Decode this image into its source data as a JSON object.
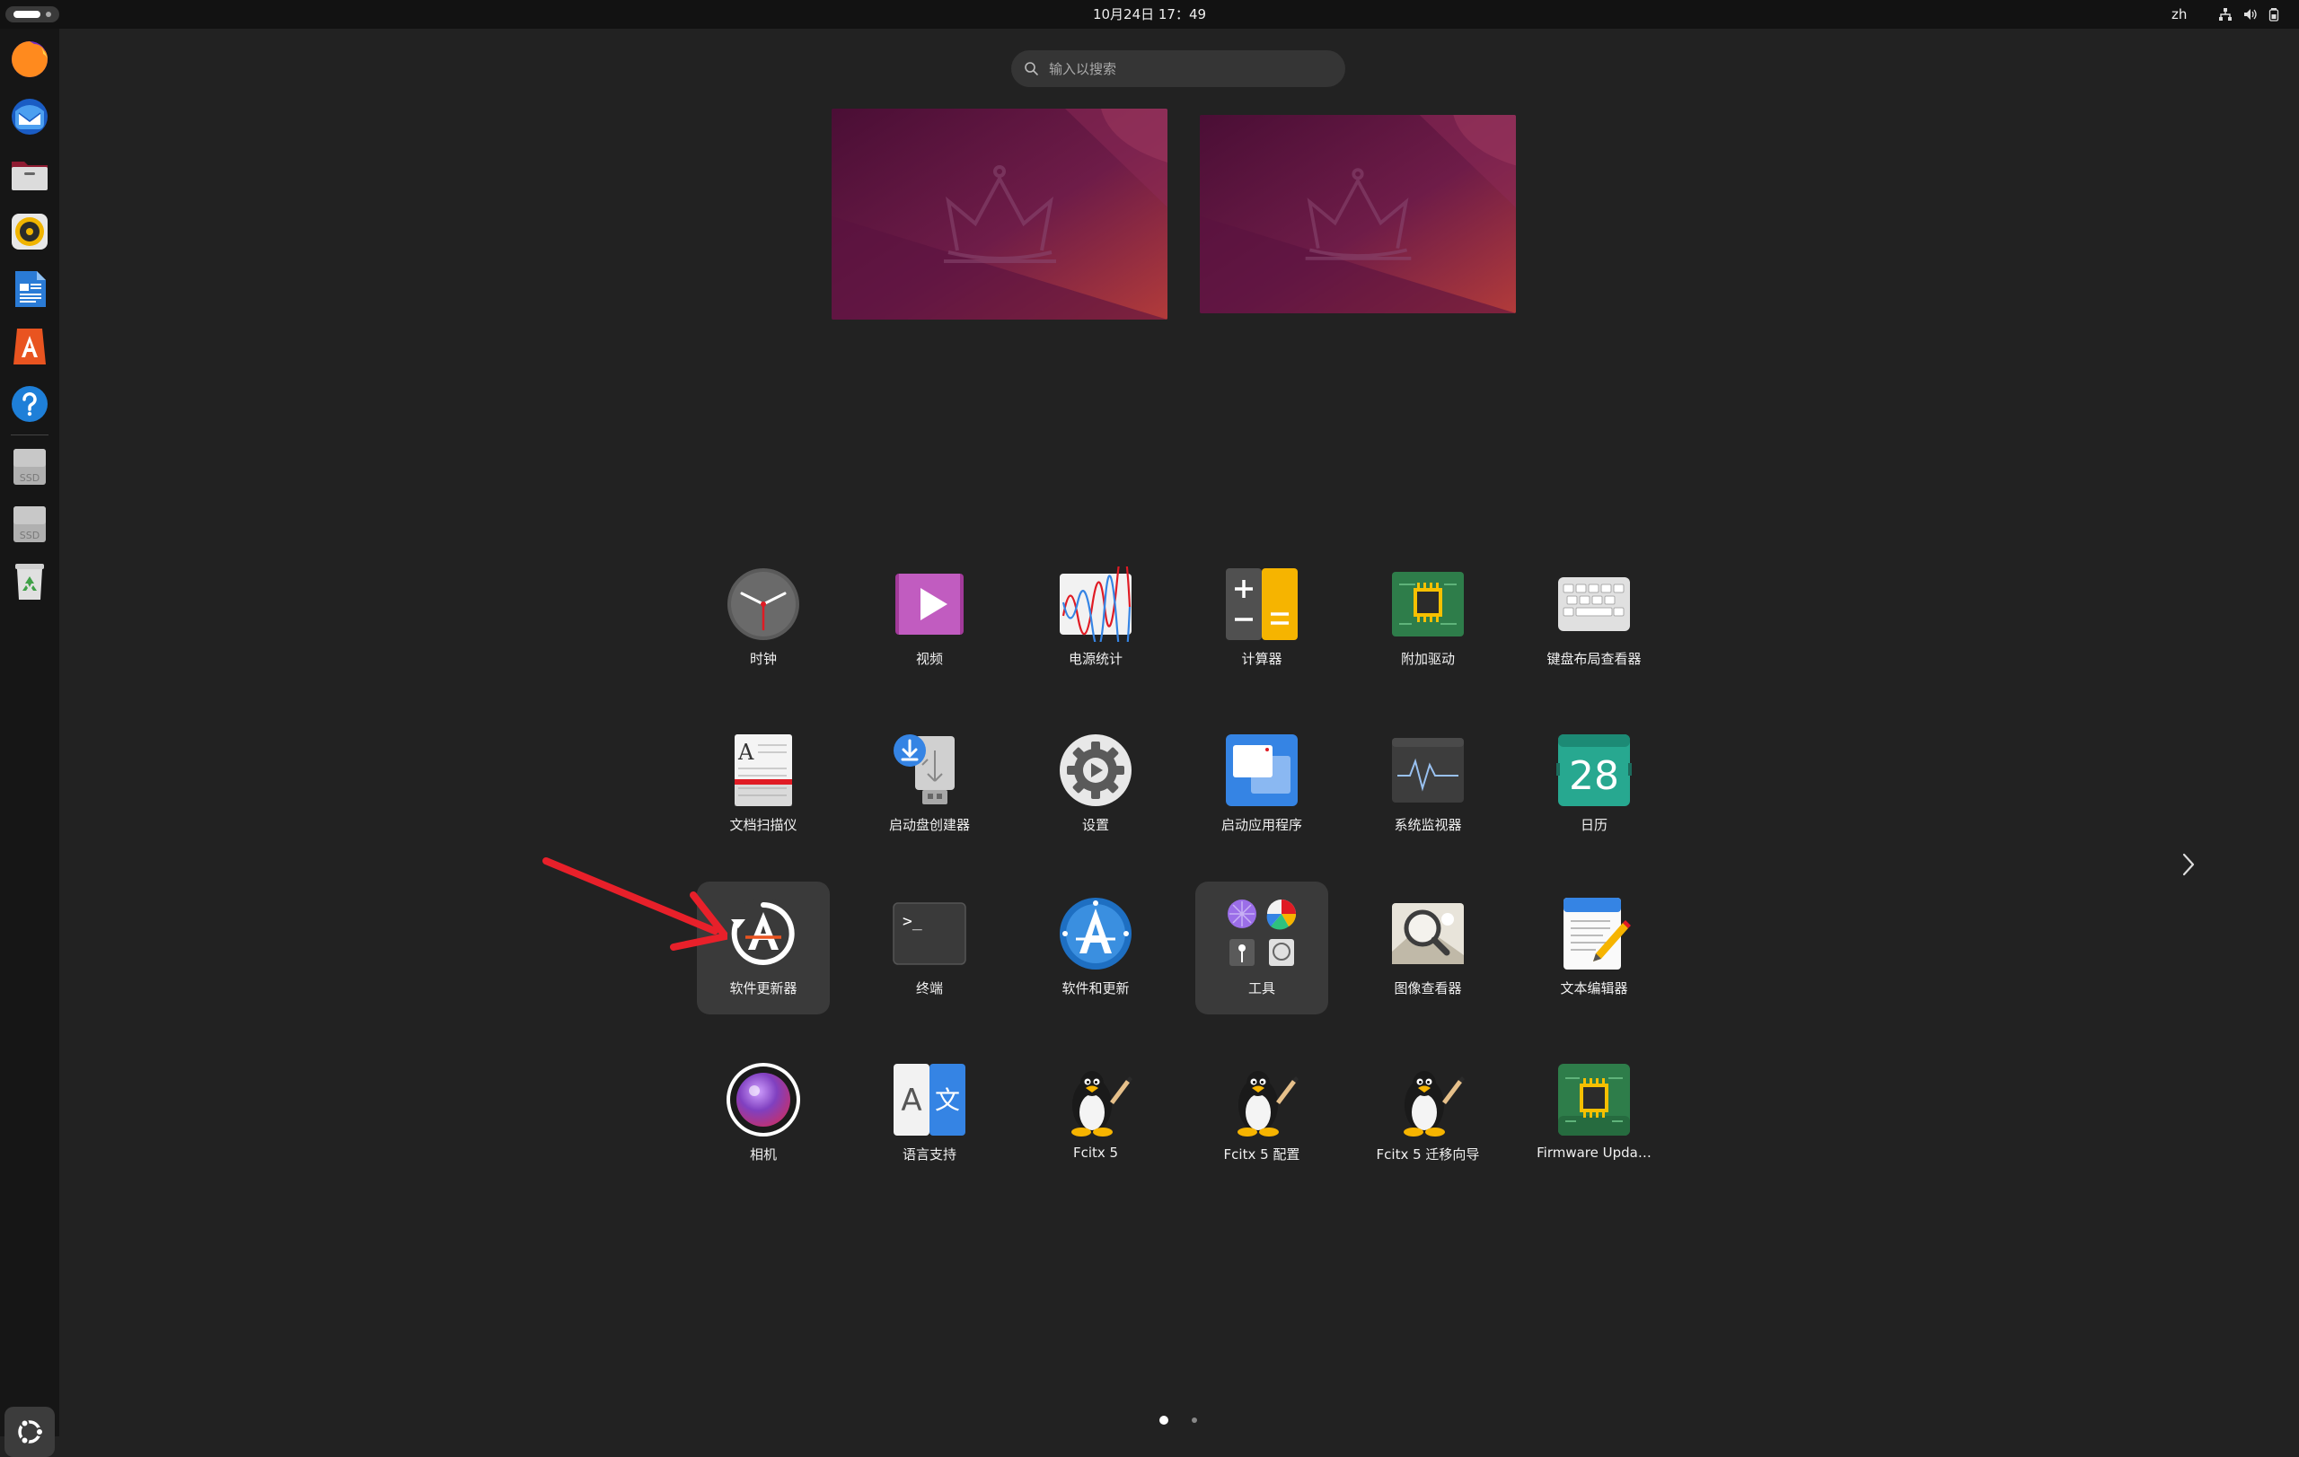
{
  "topbar": {
    "clock": "10月24日 17：49",
    "input_method": "zh",
    "tray_icons": [
      "network-icon",
      "volume-icon",
      "battery-icon"
    ]
  },
  "dock": {
    "items": [
      {
        "name": "firefox-icon"
      },
      {
        "name": "thunderbird-icon"
      },
      {
        "name": "files-icon"
      },
      {
        "name": "rhythmbox-icon"
      },
      {
        "name": "libreoffice-writer-icon"
      },
      {
        "name": "app-center-icon"
      },
      {
        "name": "help-icon"
      },
      {
        "name": "ssd-drive-icon",
        "label": "SSD"
      },
      {
        "name": "ssd-drive-icon",
        "label": "SSD"
      },
      {
        "name": "trash-icon"
      }
    ],
    "show_apps": "show-apps-icon"
  },
  "search": {
    "placeholder": "输入以搜索"
  },
  "apps": [
    {
      "label": "时钟",
      "icon": "clock-icon"
    },
    {
      "label": "视频",
      "icon": "video-icon"
    },
    {
      "label": "电源统计",
      "icon": "power-statistics-icon"
    },
    {
      "label": "计算器",
      "icon": "calculator-icon"
    },
    {
      "label": "附加驱动",
      "icon": "additional-drivers-icon"
    },
    {
      "label": "键盘布局查看器",
      "icon": "keyboard-layout-icon"
    },
    {
      "label": "文档扫描仪",
      "icon": "document-scanner-icon"
    },
    {
      "label": "启动盘创建器",
      "icon": "startup-disk-creator-icon"
    },
    {
      "label": "设置",
      "icon": "settings-icon"
    },
    {
      "label": "启动应用程序",
      "icon": "startup-applications-icon"
    },
    {
      "label": "系统监视器",
      "icon": "system-monitor-icon"
    },
    {
      "label": "日历",
      "icon": "calendar-icon",
      "day": "28"
    },
    {
      "label": "软件更新器",
      "icon": "software-updater-icon",
      "selected": true
    },
    {
      "label": "终端",
      "icon": "terminal-icon",
      "prompt": ">_"
    },
    {
      "label": "软件和更新",
      "icon": "software-and-updates-icon"
    },
    {
      "label": "工具",
      "icon": "utilities-folder-icon",
      "folder": true
    },
    {
      "label": "图像查看器",
      "icon": "image-viewer-icon"
    },
    {
      "label": "文本编辑器",
      "icon": "text-editor-icon"
    },
    {
      "label": "相机",
      "icon": "camera-icon"
    },
    {
      "label": "语言支持",
      "icon": "language-support-icon",
      "glyph_a": "A",
      "glyph_b": "文"
    },
    {
      "label": "Fcitx 5",
      "icon": "tux-penguin-icon"
    },
    {
      "label": "Fcitx 5 配置",
      "icon": "tux-penguin-icon"
    },
    {
      "label": "Fcitx 5 迁移向导",
      "icon": "tux-penguin-icon"
    },
    {
      "label": "Firmware Upda…",
      "icon": "firmware-updater-icon"
    }
  ],
  "pagination": {
    "pages": 2,
    "current": 1
  },
  "colors": {
    "accent": "#E95420",
    "annotation": "#E8202A",
    "background": "#222222"
  }
}
